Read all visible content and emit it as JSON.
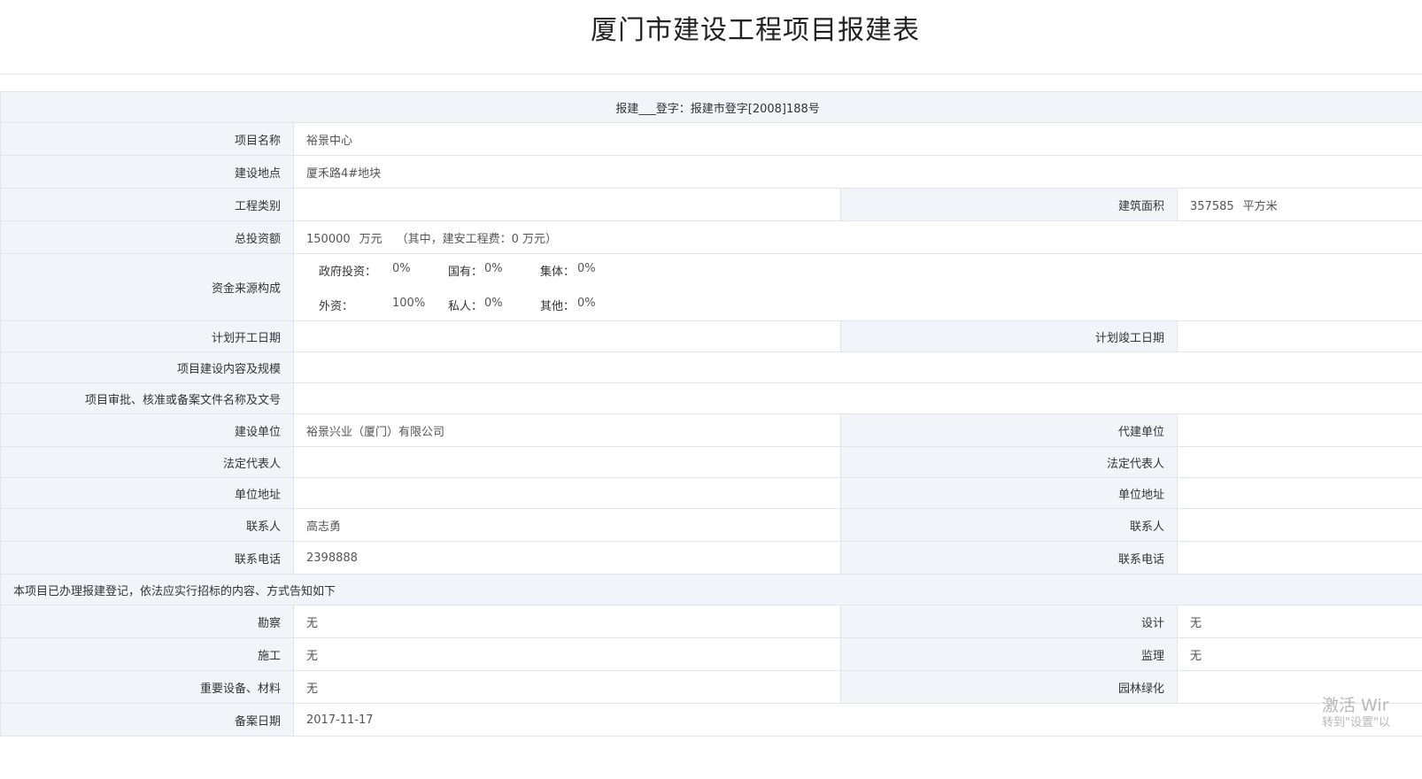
{
  "title": "厦门市建设工程项目报建表",
  "header_row": "报建___登字：报建市登字[2008]188号",
  "project_name": {
    "label": "项目名称",
    "value": "裕景中心"
  },
  "location": {
    "label": "建设地点",
    "value": "厦禾路4#地块"
  },
  "category": {
    "label": "工程类别",
    "value": ""
  },
  "area": {
    "label": "建筑面积",
    "value": "357585",
    "unit": "平方米"
  },
  "investment": {
    "label": "总投资额",
    "value": "150000",
    "unit": "万元",
    "note": "（其中，建安工程费：0 万元）"
  },
  "funding": {
    "label": "资金来源构成",
    "gov_label": "政府投资：",
    "gov_value": "0%",
    "state_label": "国有：",
    "state_value": "0%",
    "collective_label": "集体：",
    "collective_value": "0%",
    "foreign_label": "外资：",
    "foreign_value": "100%",
    "private_label": "私人：",
    "private_value": "0%",
    "other_label": "其他：",
    "other_value": "0%"
  },
  "plan_start": {
    "label": "计划开工日期",
    "value": ""
  },
  "plan_end": {
    "label": "计划竣工日期",
    "value": ""
  },
  "content_scale": {
    "label": "项目建设内容及规模",
    "value": ""
  },
  "approval_docs": {
    "label": "项目审批、核准或备案文件名称及文号",
    "value": ""
  },
  "builder": {
    "label": "建设单位",
    "value": "裕景兴业（厦门）有限公司"
  },
  "agent": {
    "label": "代建单位",
    "value": ""
  },
  "legal_rep_left": {
    "label": "法定代表人",
    "value": ""
  },
  "legal_rep_right": {
    "label": "法定代表人",
    "value": ""
  },
  "address_left": {
    "label": "单位地址",
    "value": ""
  },
  "address_right": {
    "label": "单位地址",
    "value": ""
  },
  "contact_left": {
    "label": "联系人",
    "value": "高志勇"
  },
  "contact_right": {
    "label": "联系人",
    "value": ""
  },
  "phone_left": {
    "label": "联系电话",
    "value": "2398888"
  },
  "phone_right": {
    "label": "联系电话",
    "value": ""
  },
  "notice": "本项目已办理报建登记，依法应实行招标的内容、方式告知如下",
  "survey": {
    "label": "勘察",
    "value": "无"
  },
  "design": {
    "label": "设计",
    "value": "无"
  },
  "construction": {
    "label": "施工",
    "value": "无"
  },
  "supervision": {
    "label": "监理",
    "value": "无"
  },
  "equipment": {
    "label": "重要设备、材料",
    "value": "无"
  },
  "landscaping": {
    "label": "园林绿化",
    "value": ""
  },
  "record_date": {
    "label": "备案日期",
    "value": "2017-11-17"
  },
  "watermark": {
    "line1": "激活 Wir",
    "line2": "转到\"设置\"以"
  }
}
